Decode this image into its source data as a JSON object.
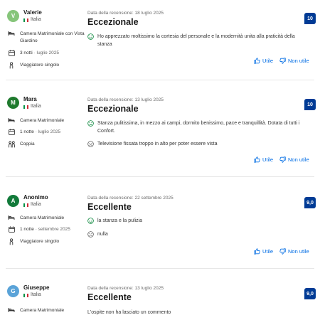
{
  "labels": {
    "helpful": "Utile",
    "not_helpful": "Non utile"
  },
  "colors": {
    "score_bg": "#003b95",
    "link": "#006ce4",
    "positive": "#008234",
    "negative": "#595959"
  },
  "reviews": [
    {
      "initial": "V",
      "avatar_color": "#86c57a",
      "name": "Valerie",
      "country": "Italia",
      "room": "Camera Matrimoniale con Vista Giardino",
      "nights": "3 notti",
      "period": "luglio 2025",
      "traveler": "Viaggiatore singolo",
      "traveler_icon": "person-icon",
      "date": "Data della recensione: 18 luglio 2025",
      "title": "Eccezionale",
      "score": "10",
      "positive": "Ho apprezzato moltissimo la cortesia del personale e la modernità unita alla praticità della stanza"
    },
    {
      "initial": "M",
      "avatar_color": "#1f7a2e",
      "name": "Mara",
      "country": "Italia",
      "room": "Camera Matrimoniale",
      "nights": "1 notte",
      "period": "luglio 2025",
      "traveler": "Coppia",
      "traveler_icon": "couple-icon",
      "date": "Data della recensione: 13 luglio 2025",
      "title": "Eccezionale",
      "score": "10",
      "positive": "Stanza pulitissima, in mezzo ai campi, dormito benissimo, pace e tranquillità. Dotata di tutti i Confort.",
      "negative": "Televisione fissata troppo in alto per poter essere vista"
    },
    {
      "initial": "A",
      "avatar_color": "#127a3a",
      "name": "Anonimo",
      "country": "Italia",
      "room": "Camera Matrimoniale",
      "nights": "1 notte",
      "period": "settembre 2025",
      "traveler": "Viaggiatore singolo",
      "traveler_icon": "person-icon",
      "date": "Data della recensione: 22 settembre 2025",
      "title": "Eccellente",
      "score": "9,0",
      "positive": "la stanza e la pulizia",
      "negative": "nulla"
    },
    {
      "initial": "G",
      "avatar_color": "#5aa3d8",
      "name": "Giuseppe",
      "country": "Italia",
      "room": "Camera Matrimoniale",
      "date": "Data della recensione: 13 luglio 2025",
      "title": "Eccellente",
      "score": "9,0",
      "no_comment": "L'ospite non ha lasciato un commento"
    }
  ]
}
